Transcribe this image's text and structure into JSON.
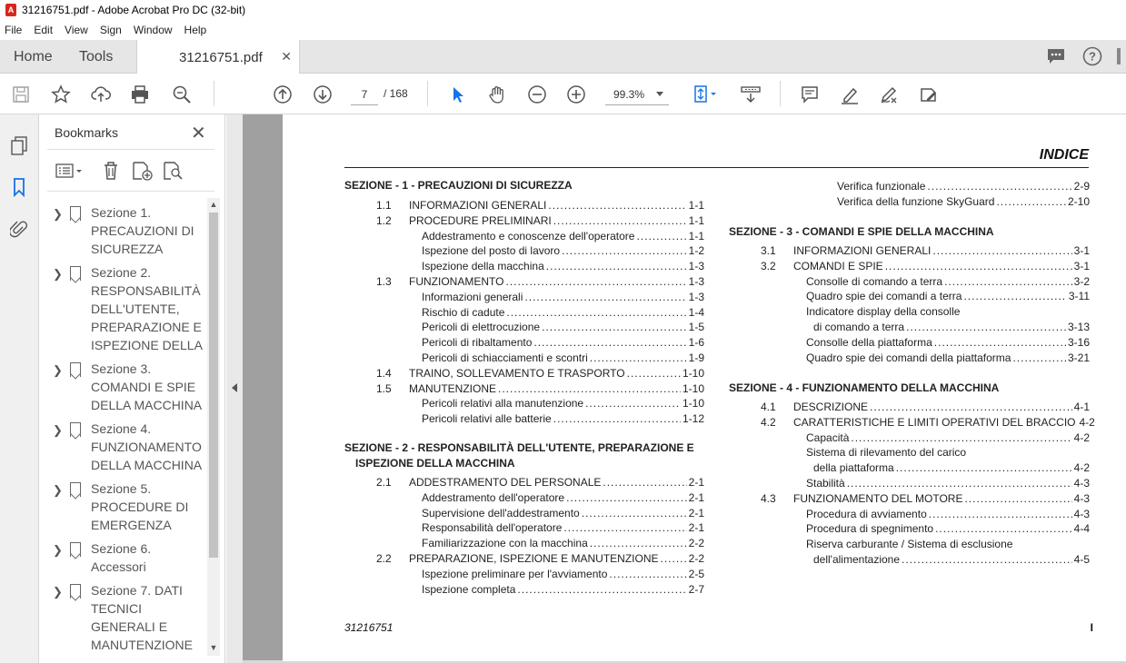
{
  "window": {
    "title": "31216751.pdf - Adobe Acrobat Pro DC (32-bit)"
  },
  "menu": [
    "File",
    "Edit",
    "View",
    "Sign",
    "Window",
    "Help"
  ],
  "tabs": {
    "home": "Home",
    "tools": "Tools",
    "doc": "31216751.pdf"
  },
  "toolbar": {
    "page_current": "7",
    "page_total": "/  168",
    "zoom": "99.3%"
  },
  "bookmarks": {
    "title": "Bookmarks",
    "items": [
      {
        "label": "Sezione 1. PRECAUZIONI DI SICUREZZA"
      },
      {
        "label": "Sezione 2. RESPONSABILITÀ DELL'UTENTE, PREPARAZIONE E ISPEZIONE DELLA"
      },
      {
        "label": "Sezione 3. COMANDI E SPIE DELLA MACCHINA"
      },
      {
        "label": "Sezione 4. FUNZIONAMENTO DELLA MACCHINA"
      },
      {
        "label": "Sezione 5. PROCEDURE DI EMERGENZA"
      },
      {
        "label": "Sezione 6. Accessori"
      },
      {
        "label": "Sezione 7. DATI TECNICI GENERALI E MANUTENZIONE"
      }
    ]
  },
  "doc": {
    "heading": "INDICE",
    "footer_left": "31216751",
    "footer_right": "I",
    "left": {
      "s1": "SEZIONE - 1 - PRECAUZIONI DI SICUREZZA",
      "s1_rows": [
        {
          "n": "1.1",
          "t": "INFORMAZIONI GENERALI",
          "p": "1-1",
          "i": 0
        },
        {
          "n": "1.2",
          "t": "PROCEDURE PRELIMINARI",
          "p": "1-1",
          "i": 0
        },
        {
          "n": "",
          "t": "Addestramento e conoscenze dell'operatore",
          "p": "1-1",
          "i": 1
        },
        {
          "n": "",
          "t": "Ispezione del posto di lavoro",
          "p": "1-2",
          "i": 1
        },
        {
          "n": "",
          "t": "Ispezione della macchina",
          "p": "1-3",
          "i": 1
        },
        {
          "n": "1.3",
          "t": "FUNZIONAMENTO",
          "p": "1-3",
          "i": 0
        },
        {
          "n": "",
          "t": "Informazioni generali",
          "p": "1-3",
          "i": 1
        },
        {
          "n": "",
          "t": "Rischio di cadute",
          "p": "1-4",
          "i": 1
        },
        {
          "n": "",
          "t": "Pericoli di elettrocuzione",
          "p": "1-5",
          "i": 1
        },
        {
          "n": "",
          "t": "Pericoli di ribaltamento",
          "p": "1-6",
          "i": 1
        },
        {
          "n": "",
          "t": "Pericoli di schiacciamenti e scontri",
          "p": "1-9",
          "i": 1
        },
        {
          "n": "1.4",
          "t": "TRAINO, SOLLEVAMENTO E TRASPORTO",
          "p": "1-10",
          "i": 0
        },
        {
          "n": "1.5",
          "t": "MANUTENZIONE",
          "p": "1-10",
          "i": 0
        },
        {
          "n": "",
          "t": "Pericoli relativi alla manutenzione",
          "p": "1-10",
          "i": 1
        },
        {
          "n": "",
          "t": "Pericoli relativi alle batterie",
          "p": "1-12",
          "i": 1
        }
      ],
      "s2_line1": "SEZIONE - 2 - RESPONSABILITÀ DELL'UTENTE, PREPARAZIONE E",
      "s2_line2": "ISPEZIONE DELLA MACCHINA",
      "s2_rows": [
        {
          "n": "2.1",
          "t": "ADDESTRAMENTO DEL PERSONALE",
          "p": "2-1",
          "i": 0
        },
        {
          "n": "",
          "t": "Addestramento dell'operatore",
          "p": "2-1",
          "i": 1
        },
        {
          "n": "",
          "t": "Supervisione dell'addestramento",
          "p": "2-1",
          "i": 1
        },
        {
          "n": "",
          "t": "Responsabilità dell'operatore",
          "p": "2-1",
          "i": 1
        },
        {
          "n": "",
          "t": "Familiarizzazione con la macchina",
          "p": "2-2",
          "i": 1
        },
        {
          "n": "2.2",
          "t": "PREPARAZIONE, ISPEZIONE E MANUTENZIONE",
          "p": "2-2",
          "i": 0
        },
        {
          "n": "",
          "t": "Ispezione preliminare per l'avviamento",
          "p": "2-5",
          "i": 1
        },
        {
          "n": "",
          "t": "Ispezione completa",
          "p": "2-7",
          "i": 1
        }
      ]
    },
    "right": {
      "top_rows": [
        {
          "n": "",
          "t": "Verifica funzionale",
          "p": "2-9",
          "i": 1
        },
        {
          "n": "",
          "t": "Verifica della funzione SkyGuard",
          "p": "2-10",
          "i": 1
        }
      ],
      "s3": "SEZIONE - 3 - COMANDI E SPIE DELLA MACCHINA",
      "s3_rows": [
        {
          "n": "3.1",
          "t": "INFORMAZIONI GENERALI",
          "p": "3-1",
          "i": 0
        },
        {
          "n": "3.2",
          "t": "COMANDI E SPIE",
          "p": "3-1",
          "i": 0
        },
        {
          "n": "",
          "t": "Consolle di comando a terra",
          "p": "3-2",
          "i": 1
        },
        {
          "n": "",
          "t": "Quadro spie dei comandi a terra",
          "p": "3-11",
          "i": 1
        },
        {
          "n": "",
          "t": "Indicatore display della consolle",
          "p": "",
          "i": 1
        },
        {
          "n": "",
          "t": "di comando a terra",
          "p": "3-13",
          "i": 2
        },
        {
          "n": "",
          "t": "Consolle della piattaforma",
          "p": "3-16",
          "i": 1
        },
        {
          "n": "",
          "t": "Quadro spie dei comandi della piattaforma",
          "p": "3-21",
          "i": 1
        }
      ],
      "s4": "SEZIONE - 4 - FUNZIONAMENTO DELLA MACCHINA",
      "s4_rows": [
        {
          "n": "4.1",
          "t": "DESCRIZIONE",
          "p": "4-1",
          "i": 0
        },
        {
          "n": "4.2",
          "t": "CARATTERISTICHE E LIMITI OPERATIVI DEL BRACCIO",
          "p": "4-2",
          "i": 0
        },
        {
          "n": "",
          "t": "Capacità",
          "p": "4-2",
          "i": 1
        },
        {
          "n": "",
          "t": "Sistema di rilevamento del carico",
          "p": "",
          "i": 1
        },
        {
          "n": "",
          "t": "della piattaforma",
          "p": "4-2",
          "i": 2
        },
        {
          "n": "",
          "t": "Stabilità",
          "p": "4-3",
          "i": 1
        },
        {
          "n": "4.3",
          "t": "FUNZIONAMENTO DEL MOTORE",
          "p": "4-3",
          "i": 0
        },
        {
          "n": "",
          "t": "Procedura di avviamento",
          "p": "4-3",
          "i": 1
        },
        {
          "n": "",
          "t": "Procedura di spegnimento",
          "p": "4-4",
          "i": 1
        },
        {
          "n": "",
          "t": "Riserva carburante / Sistema di esclusione",
          "p": "",
          "i": 1
        },
        {
          "n": "",
          "t": "dell'alimentazione",
          "p": "4-5",
          "i": 2
        }
      ]
    }
  }
}
